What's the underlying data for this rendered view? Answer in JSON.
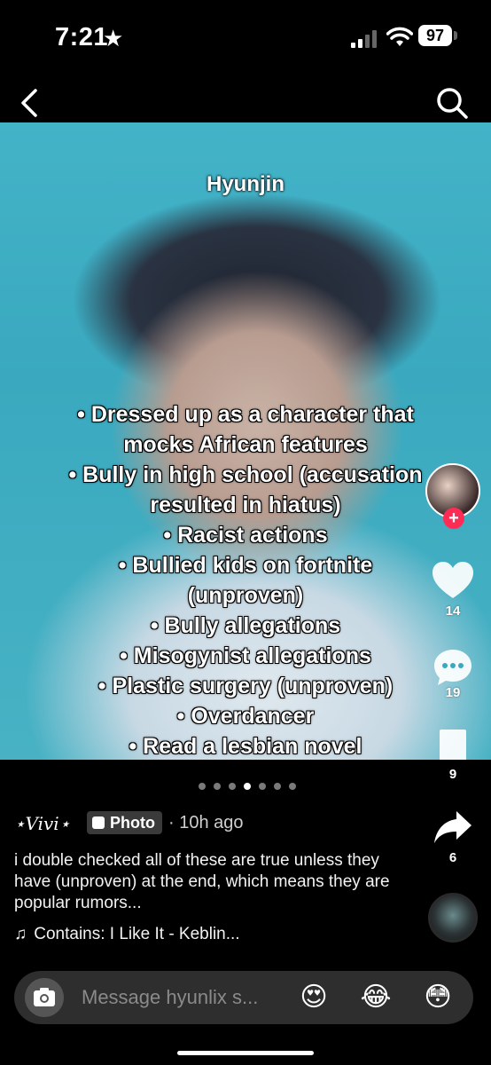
{
  "status_bar": {
    "time": "7:21",
    "battery": "97"
  },
  "photo": {
    "title": "Hyunjin",
    "lines": [
      "• Dressed up as a character that",
      "mocks African features",
      "• Bully in high school (accusation",
      "resulted in hiatus)",
      "• Racist actions",
      "• Bullied kids on fortnite",
      "(unproven)",
      "• Bully allegations",
      "• Misogynist allegations",
      "• Plastic surgery (unproven)",
      "• Overdancer",
      "• Read a lesbian novel"
    ]
  },
  "rail": {
    "likes": "14",
    "comments": "19",
    "bookmarks": "9",
    "shares": "6",
    "follow_symbol": "+"
  },
  "carousel": {
    "total": 7,
    "active_index": 3
  },
  "post": {
    "author": "⋆Vivi⋆",
    "badge": "Photo",
    "time": "· 10h ago",
    "caption": "i double checked all of these are true unless they have (unproven) at the end, which means they are popular rumors...",
    "music": "Contains: I Like It - Keblin..."
  },
  "message_bar": {
    "placeholder": "Message hyunlix s...",
    "emojis": [
      "😍",
      "😂",
      "😳"
    ]
  },
  "icons": {
    "back": "chevron-left-icon",
    "search": "search-icon",
    "like": "heart-icon",
    "comment": "comment-icon",
    "bookmark": "bookmark-icon",
    "share": "share-icon",
    "camera": "camera-icon"
  },
  "colors": {
    "accent": "#fe2c55",
    "photo_bg": "#43b3c8"
  }
}
